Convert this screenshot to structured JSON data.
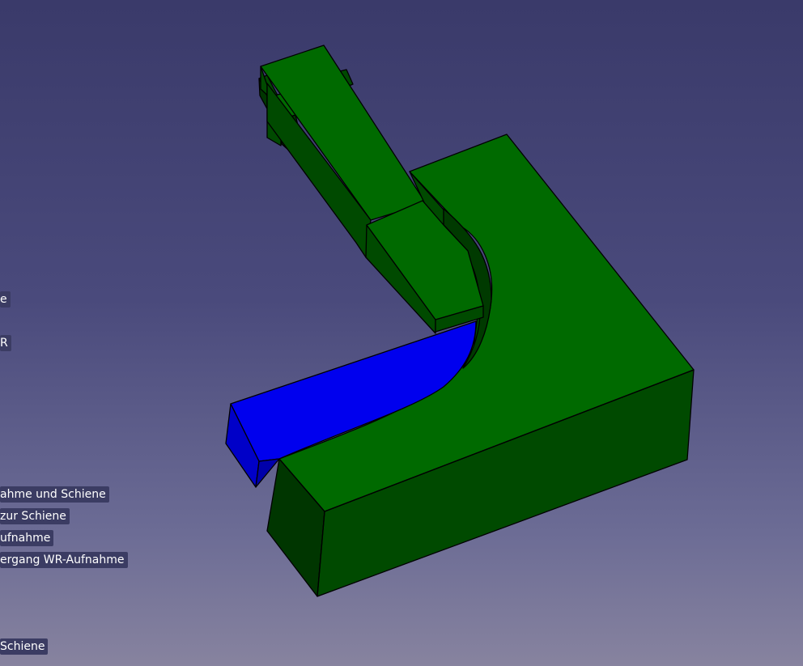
{
  "viewport": {
    "background_top": "#3a3a6a",
    "background_bottom": "#87839f"
  },
  "colors": {
    "face_top": "#006a00",
    "face_side": "#004a00",
    "face_dark": "#003600",
    "selected_top": "#0000ee",
    "selected_side": "#0000c8",
    "edge": "#000000"
  },
  "overlay_labels": [
    "e",
    "R",
    "ahme  und Schiene",
    " zur Schiene",
    "ufnahme",
    "ergang WR-Aufnahme",
    " Schiene"
  ]
}
